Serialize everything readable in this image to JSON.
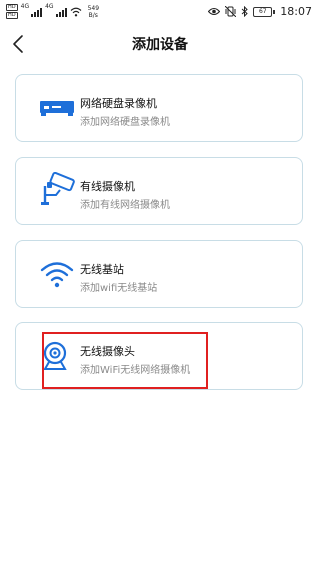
{
  "status_bar": {
    "sim1": "HD",
    "sim2": "HD",
    "net1": "4G",
    "net2": "4G",
    "speed_value": "549",
    "speed_unit": "B/s",
    "battery": "67",
    "time": "18:07"
  },
  "header": {
    "title": "添加设备"
  },
  "devices": [
    {
      "title": "网络硬盘录像机",
      "subtitle": "添加网络硬盘录像机",
      "icon": "nvr-icon"
    },
    {
      "title": "有线摄像机",
      "subtitle": "添加有线网络摄像机",
      "icon": "wired-camera-icon"
    },
    {
      "title": "无线基站",
      "subtitle": "添加wifi无线基站",
      "icon": "wifi-icon"
    },
    {
      "title": "无线摄像头",
      "subtitle": "添加WiFi无线网络摄像机",
      "icon": "webcam-icon"
    }
  ],
  "colors": {
    "accent": "#1e6fd9",
    "card_border": "#c8dde6",
    "highlight": "#e02020"
  }
}
